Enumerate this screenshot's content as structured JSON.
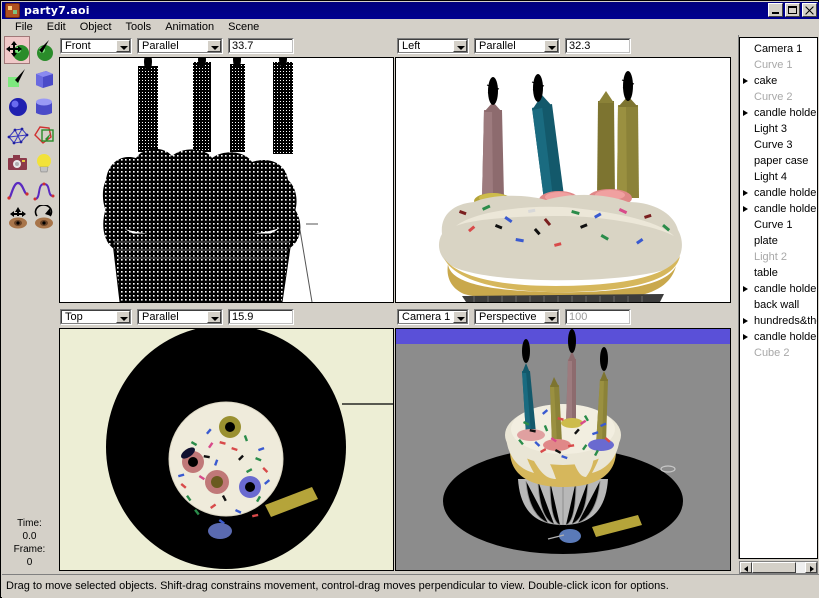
{
  "window": {
    "title": "party7.aoi",
    "buttons": {
      "minimize": "_",
      "maximize": "□",
      "close": "✕"
    }
  },
  "menubar": {
    "items": [
      "File",
      "Edit",
      "Object",
      "Tools",
      "Animation",
      "Scene"
    ]
  },
  "palette": {
    "tools": [
      {
        "name": "move-object-tool",
        "selected": true
      },
      {
        "name": "rotate-object-tool",
        "selected": false
      },
      {
        "name": "create-plane-tool",
        "selected": false
      },
      {
        "name": "create-cube-tool",
        "selected": false
      },
      {
        "name": "create-sphere-tool",
        "selected": false
      },
      {
        "name": "create-cylinder-tool",
        "selected": false
      },
      {
        "name": "create-mesh-tool",
        "selected": false
      },
      {
        "name": "create-polygon-tool",
        "selected": false
      },
      {
        "name": "create-camera-tool",
        "selected": false
      },
      {
        "name": "create-light-tool",
        "selected": false
      },
      {
        "name": "create-curve-tool",
        "selected": false
      },
      {
        "name": "create-spline-tool",
        "selected": false
      },
      {
        "name": "pan-view-tool",
        "selected": false
      },
      {
        "name": "rotate-view-tool",
        "selected": false
      }
    ]
  },
  "timeline": {
    "time_label": "Time:",
    "time_value": "0.0",
    "frame_label": "Frame:",
    "frame_value": "0"
  },
  "viewports": [
    {
      "view": "Front",
      "projection": "Parallel",
      "scale": "33.7",
      "scale_disabled": false
    },
    {
      "view": "Left",
      "projection": "Parallel",
      "scale": "32.3",
      "scale_disabled": false
    },
    {
      "view": "Top",
      "projection": "Parallel",
      "scale": "15.9",
      "scale_disabled": false
    },
    {
      "view": "Camera 1",
      "projection": "Perspective",
      "scale": "100",
      "scale_disabled": true
    }
  ],
  "object_tree": {
    "items": [
      {
        "label": "Camera 1",
        "expandable": false,
        "dim": false
      },
      {
        "label": "Curve 1",
        "expandable": false,
        "dim": true
      },
      {
        "label": "cake",
        "expandable": true,
        "dim": false
      },
      {
        "label": "Curve 2",
        "expandable": false,
        "dim": true
      },
      {
        "label": "candle holder",
        "expandable": true,
        "dim": false
      },
      {
        "label": "Light 3",
        "expandable": false,
        "dim": false
      },
      {
        "label": "Curve 3",
        "expandable": false,
        "dim": false
      },
      {
        "label": "paper case",
        "expandable": false,
        "dim": false
      },
      {
        "label": "Light 4",
        "expandable": false,
        "dim": false
      },
      {
        "label": "candle holder",
        "expandable": true,
        "dim": false
      },
      {
        "label": "candle holder",
        "expandable": true,
        "dim": false
      },
      {
        "label": "Curve 1",
        "expandable": false,
        "dim": false
      },
      {
        "label": "plate",
        "expandable": false,
        "dim": false
      },
      {
        "label": "Light 2",
        "expandable": false,
        "dim": true
      },
      {
        "label": "table",
        "expandable": false,
        "dim": false
      },
      {
        "label": "candle holder",
        "expandable": true,
        "dim": false
      },
      {
        "label": "back wall",
        "expandable": false,
        "dim": false
      },
      {
        "label": "hundreds&thou",
        "expandable": true,
        "dim": false
      },
      {
        "label": "candle holder",
        "expandable": true,
        "dim": false
      },
      {
        "label": "Cube 2",
        "expandable": false,
        "dim": true
      }
    ]
  },
  "statusbar": {
    "message": "Drag to move selected objects.  Shift-drag constrains movement, control-drag moves perpendicular to view.  Double-click icon for options."
  },
  "colors": {
    "titlebar": "#000080",
    "chrome": "#d4d0c8",
    "selected_tool": "#f0c8c8",
    "wireframe_bg": "#ffffff",
    "top_view_bg": "#edeed5",
    "camera_view_bg": "#8c8c8c",
    "camera_sky": "#5a50d8",
    "frosting": "#e8e4d8",
    "cake": "#c9a84c",
    "plate": "#000000"
  }
}
